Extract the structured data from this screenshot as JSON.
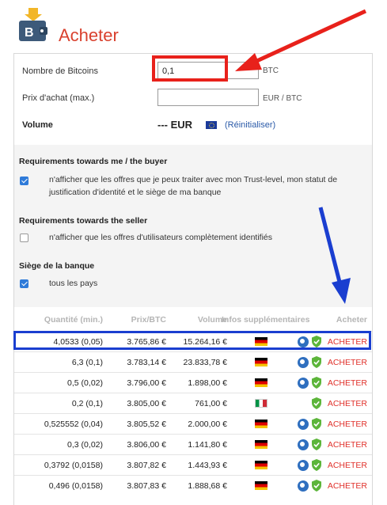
{
  "header": {
    "title": "Acheter"
  },
  "form": {
    "btc_label": "Nombre de Bitcoins",
    "btc_value": "0,1",
    "btc_unit": "BTC",
    "price_label": "Prix d'achat (max.)",
    "price_value": "",
    "price_unit": "EUR / BTC",
    "volume_label": "Volume",
    "volume_value": "--- EUR",
    "reset_label": "(Réinitialiser)"
  },
  "requirements": {
    "me_title": "Requirements towards me / the buyer",
    "me_option": "n'afficher que les offres que je peux traiter avec mon Trust-level, mon statut de justification d'identité et le siège de ma banque",
    "seller_title": "Requirements towards the seller",
    "seller_option": "n'afficher que les offres d'utilisateurs complètement identifiés",
    "bank_title": "Siège de la banque",
    "bank_option": "tous les pays"
  },
  "table": {
    "headers": {
      "quantity": "Quantité (min.)",
      "price": "Prix/BTC",
      "volume": "Volume",
      "info": "Infos supplémentaires",
      "buy": "Acheter"
    },
    "rows": [
      {
        "quantity": "4,0533 (0,05)",
        "price": "3.765,86 €",
        "volume": "15.264,16 €",
        "flag": "de",
        "bubble": true,
        "buy": "ACHETER"
      },
      {
        "quantity": "6,3 (0,1)",
        "price": "3.783,14 €",
        "volume": "23.833,78 €",
        "flag": "de",
        "bubble": true,
        "buy": "ACHETER"
      },
      {
        "quantity": "0,5 (0,02)",
        "price": "3.796,00 €",
        "volume": "1.898,00 €",
        "flag": "de",
        "bubble": true,
        "buy": "ACHETER"
      },
      {
        "quantity": "0,2 (0,1)",
        "price": "3.805,00 €",
        "volume": "761,00 €",
        "flag": "it",
        "bubble": false,
        "buy": "ACHETER"
      },
      {
        "quantity": "0,525552 (0,04)",
        "price": "3.805,52 €",
        "volume": "2.000,00 €",
        "flag": "de",
        "bubble": true,
        "buy": "ACHETER"
      },
      {
        "quantity": "0,3 (0,02)",
        "price": "3.806,00 €",
        "volume": "1.141,80 €",
        "flag": "de",
        "bubble": true,
        "buy": "ACHETER"
      },
      {
        "quantity": "0,3792 (0,0158)",
        "price": "3.807,82 €",
        "volume": "1.443,93 €",
        "flag": "de",
        "bubble": true,
        "buy": "ACHETER"
      },
      {
        "quantity": "0,496 (0,0158)",
        "price": "3.807,83 €",
        "volume": "1.888,68 €",
        "flag": "de",
        "bubble": true,
        "buy": "ACHETER"
      }
    ]
  },
  "colors": {
    "accent": "#d9412e",
    "link": "#2a5aa8",
    "annotation_red": "#e8211b",
    "annotation_blue": "#1a3ed0"
  },
  "icons": [
    "wallet-icon",
    "eu-flag-icon",
    "germany-flag-icon",
    "italy-flag-icon",
    "bubble-icon",
    "shield-check-icon"
  ]
}
